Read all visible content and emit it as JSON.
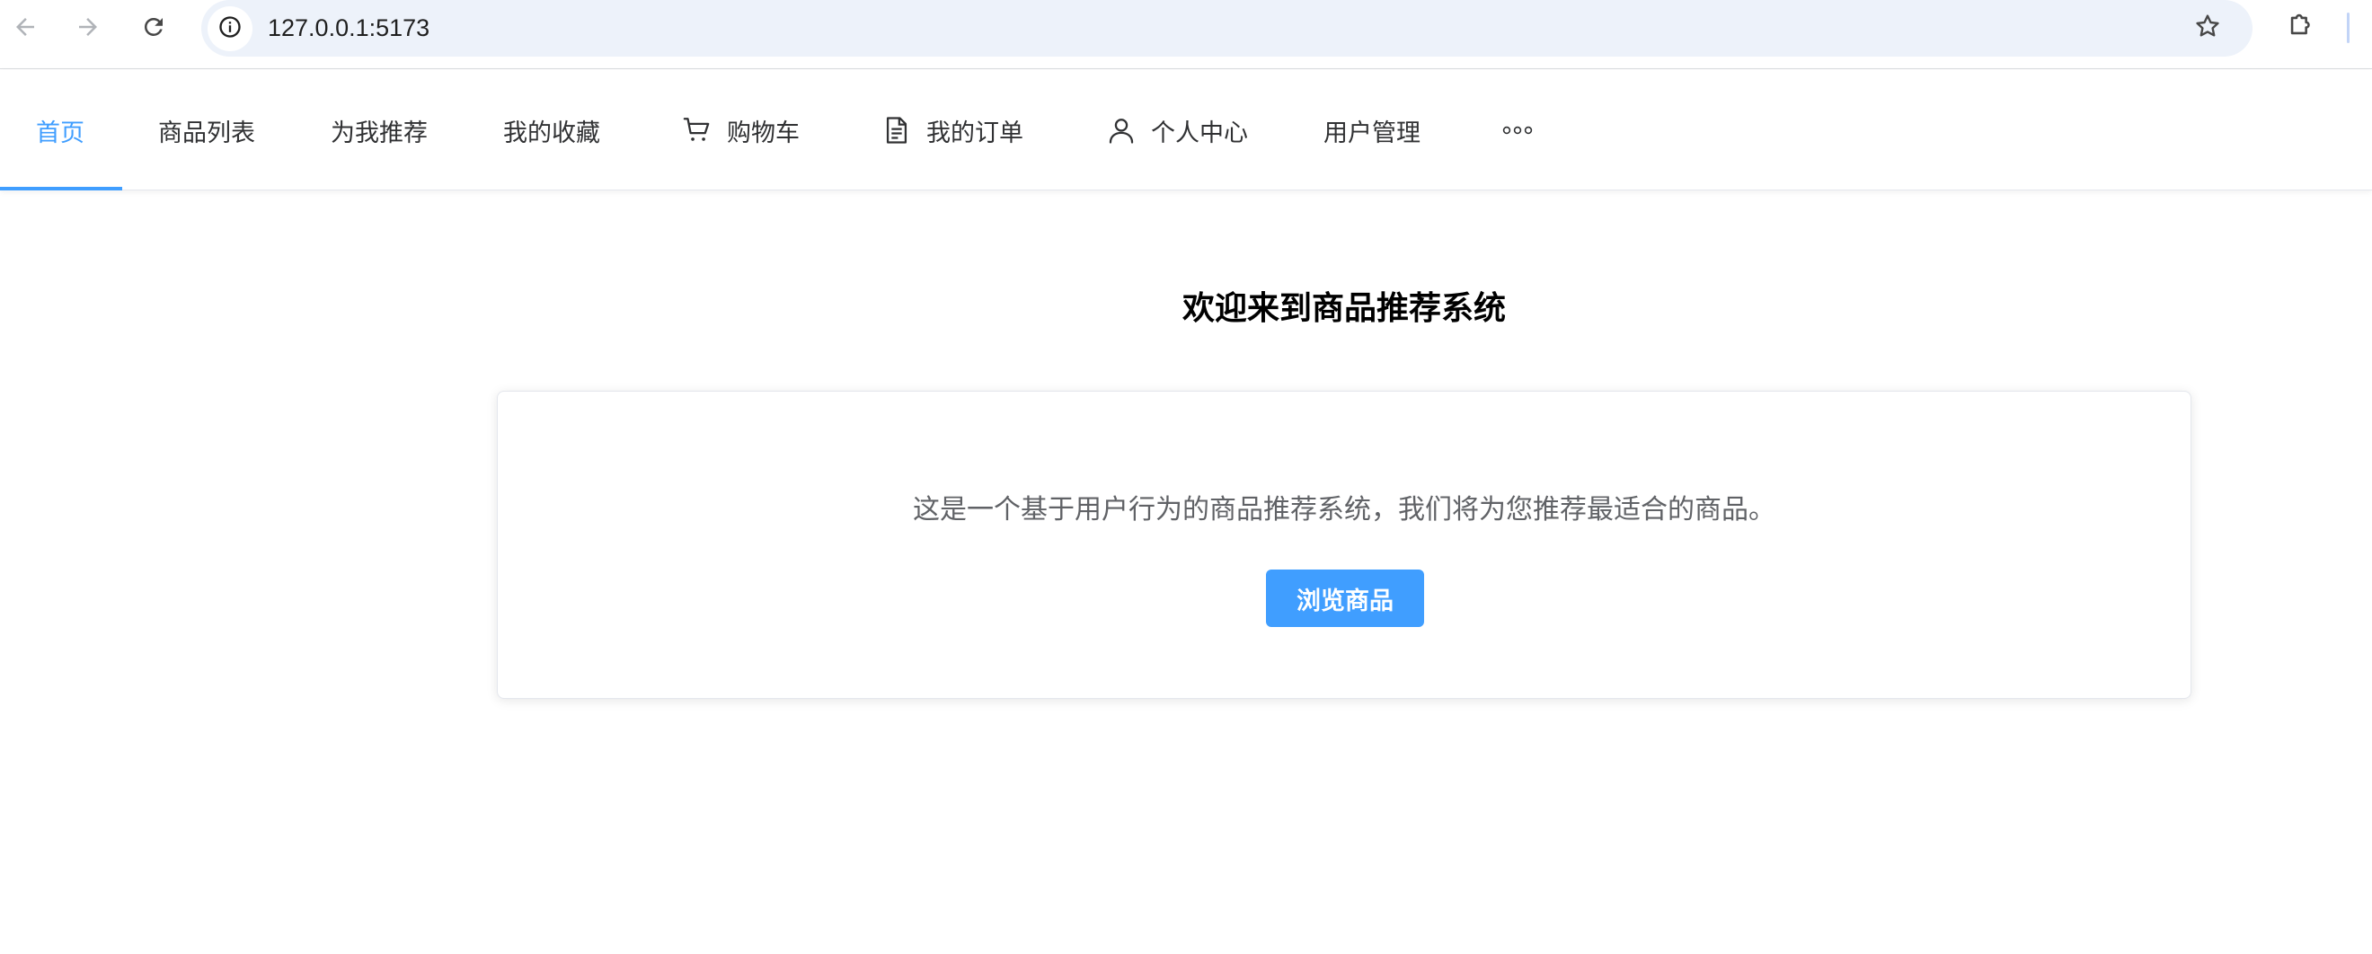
{
  "browser": {
    "url": "127.0.0.1:5173",
    "icons": {
      "back": "back-arrow-icon",
      "forward": "forward-arrow-icon",
      "reload": "reload-icon",
      "site_info": "info-icon",
      "bookmark": "star-icon",
      "extensions": "puzzle-icon"
    }
  },
  "nav": {
    "items": [
      {
        "label": "首页",
        "active": true
      },
      {
        "label": "商品列表",
        "active": false
      },
      {
        "label": "为我推荐",
        "active": false
      },
      {
        "label": "我的收藏",
        "active": false
      },
      {
        "label": "购物车",
        "icon": "cart-icon",
        "active": false
      },
      {
        "label": "我的订单",
        "icon": "document-icon",
        "active": false
      },
      {
        "label": "个人中心",
        "icon": "user-icon",
        "active": false
      },
      {
        "label": "用户管理",
        "active": false
      }
    ],
    "more_icon": "more-dots-icon"
  },
  "main": {
    "title": "欢迎来到商品推荐系统",
    "card": {
      "description": "这是一个基于用户行为的商品推荐系统，我们将为您推荐最适合的商品。",
      "button_label": "浏览商品"
    }
  },
  "colors": {
    "accent": "#409eff",
    "text": "#303133",
    "muted": "#606266"
  }
}
